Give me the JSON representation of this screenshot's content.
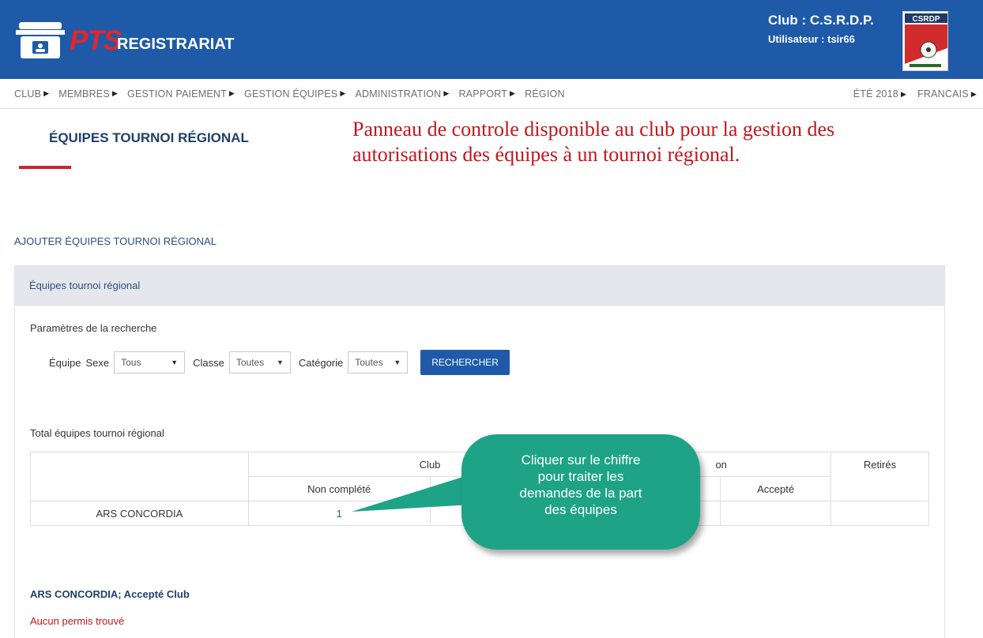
{
  "header": {
    "brand_pts": "PTS",
    "brand_name": "REGISTRARIAT",
    "club_label": "Club : C.S.R.D.P.",
    "user_label": "Utilisateur : tsir66",
    "crest_text": "CSRDP"
  },
  "nav": {
    "items": [
      "CLUB",
      "MEMBRES",
      "GESTION PAIEMENT",
      "GESTION ÉQUIPES",
      "ADMINISTRATION",
      "RAPPORT",
      "RÉGION"
    ],
    "right_items": [
      "ÉTÉ 2018",
      "FRANCAIS"
    ]
  },
  "page": {
    "title": "ÉQUIPES TOURNOI RÉGIONAL",
    "annotation": "Panneau de controle disponible au club pour la gestion des autorisations des équipes à un tournoi régional.",
    "add_link": "AJOUTER ÉQUIPES TOURNOI RÉGIONAL"
  },
  "panel": {
    "title": "Équipes tournoi régional",
    "search_title": "Paramètres de la recherche",
    "team_label": "Équipe",
    "sexe_label": "Sexe",
    "sexe_value": "Tous",
    "classe_label": "Classe",
    "classe_value": "Toutes",
    "categorie_label": "Catégorie",
    "categorie_value": "Toutes",
    "search_button": "RECHERCHER"
  },
  "totals": {
    "title": "Total équipes tournoi régional",
    "group_club": "Club",
    "group_region_suffix": "on",
    "group_retires": "Retirés",
    "col_non_complete": "Non complété",
    "col_accepte": "Accepté",
    "row_team": "ARS CONCORDIA",
    "row_non_complete_value": "1"
  },
  "callout": {
    "lines": [
      "Cliquer sur le chiffre",
      "pour traiter les",
      "demandes de la part",
      "des équipes"
    ]
  },
  "result": {
    "title": "ARS CONCORDIA; Accepté Club",
    "empty": "Aucun permis trouvé"
  },
  "colors": {
    "header_blue": "#1e5aa8",
    "accent_red": "#c4161c",
    "callout_green": "#1ea386"
  }
}
